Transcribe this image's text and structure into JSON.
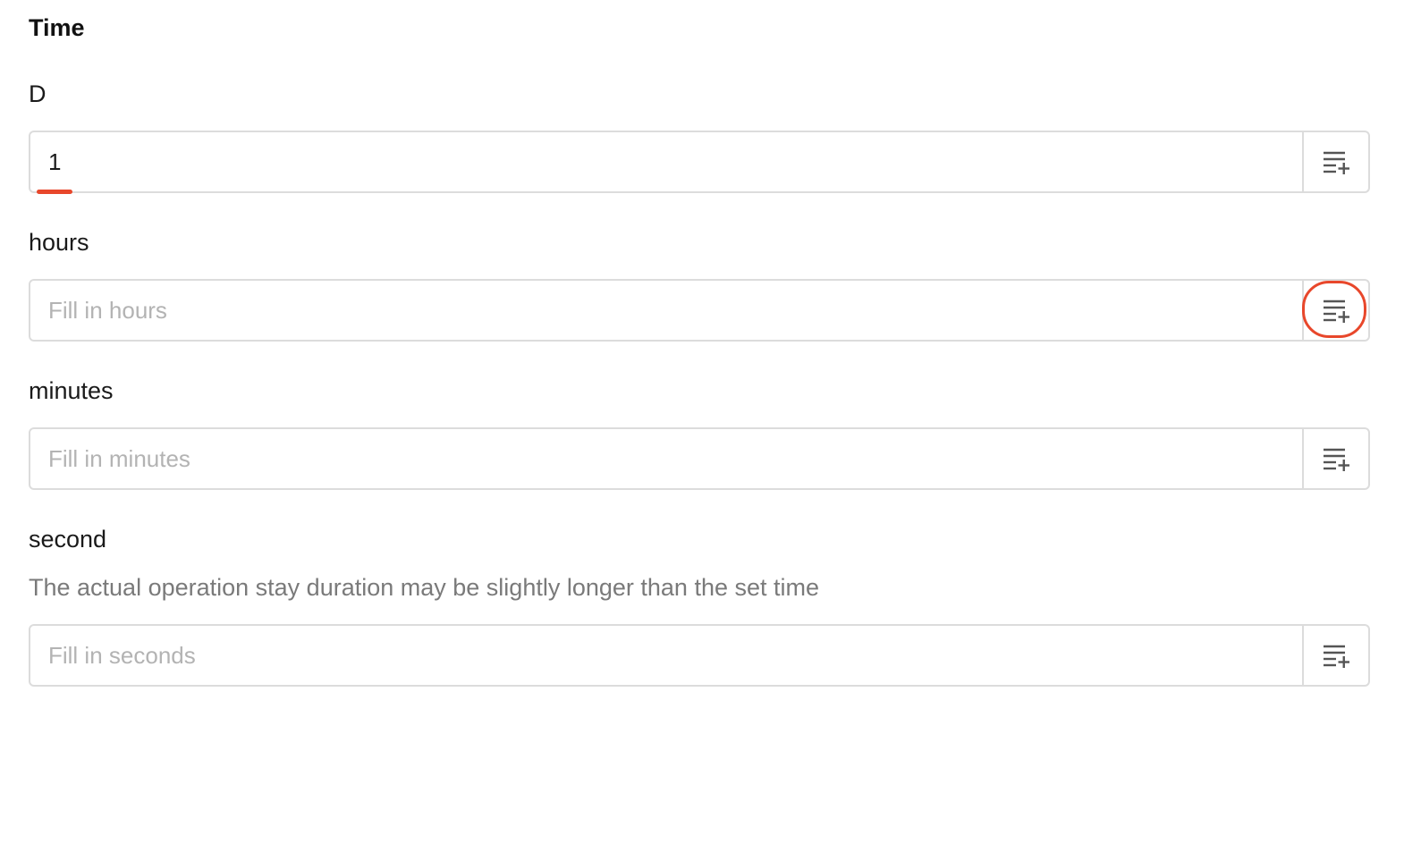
{
  "form": {
    "section_title": "Time",
    "fields": [
      {
        "label": "D",
        "value": "1",
        "placeholder": ""
      },
      {
        "label": "hours",
        "value": "",
        "placeholder": "Fill in hours"
      },
      {
        "label": "minutes",
        "value": "",
        "placeholder": "Fill in minutes"
      },
      {
        "label": "second",
        "description": "The actual operation stay duration may be slightly longer than the set time",
        "value": "",
        "placeholder": "Fill in seconds"
      }
    ],
    "insert_button_icon": "insert-variable-icon"
  },
  "annotations": {
    "underline_target": "D field value",
    "circle_target": "hours insert button",
    "color": "#e8472b"
  },
  "colors": {
    "border": "#dcdcdc",
    "placeholder": "#b3b3b3",
    "description": "#7a7a7a",
    "icon": "#555555",
    "annotation": "#e8472b"
  }
}
